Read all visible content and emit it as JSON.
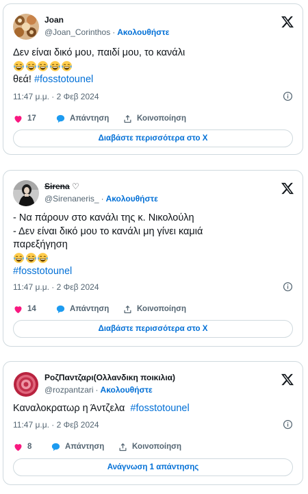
{
  "tweets": [
    {
      "name": "Joan",
      "handle": "@Joan_Corinthos",
      "separator": "·",
      "follow": "Ακολουθήστε",
      "text_line1": "Δεν είναι δικό μου, παιδί μου, το κανάλι",
      "emoji_count": 5,
      "text_line2_prefix": "θεά! ",
      "hashtag": "#fosstotounel",
      "time": "11:47 μ.μ. · 2 Φεβ 2024",
      "likes": "17",
      "reply_label": "Απάντηση",
      "share_label": "Κοινοποίηση",
      "more_button": "Διαβάστε περισσότερα στο X"
    },
    {
      "name": "Sirena",
      "name_suffix": " ♡",
      "handle": "@Sirenaneris_",
      "separator": "·",
      "follow": "Ακολουθήστε",
      "text_line1": "- Να πάρουν στο κανάλι της κ. Νικολούλη",
      "text_line2": "- Δεν είναι δικό μου το κανάλι μη γίνει καμιά",
      "text_line3": "παρεξήγηση",
      "emoji_count": 3,
      "hashtag": "#fosstotounel",
      "time": "11:47 μ.μ. · 2 Φεβ 2024",
      "likes": "14",
      "reply_label": "Απάντηση",
      "share_label": "Κοινοποίηση",
      "more_button": "Διαβάστε περισσότερα στο X"
    },
    {
      "name": "ΡοζΠαντζαρι(Ολλανδικη ποικιλια)",
      "handle": "@rozpantzari",
      "separator": "·",
      "follow": "Ακολουθήστε",
      "text_line1": "Καναλοκρατωρ η Άντζελα  ",
      "hashtag": "#fosstotounel",
      "time": "11:47 μ.μ. · 2 Φεβ 2024",
      "likes": "8",
      "reply_label": "Απάντηση",
      "share_label": "Κοινοποίηση",
      "more_button": "Ανάγνωση 1 απάντησης"
    }
  ],
  "colors": {
    "link": "#006fd6",
    "muted": "#536471",
    "like": "#f91880",
    "reply": "#1d9bf0",
    "border": "#cfd9de"
  },
  "icons": [
    "x-logo-icon",
    "info-icon",
    "heart-icon",
    "reply-bubble-icon",
    "share-icon",
    "laughing-tears-emoji"
  ]
}
